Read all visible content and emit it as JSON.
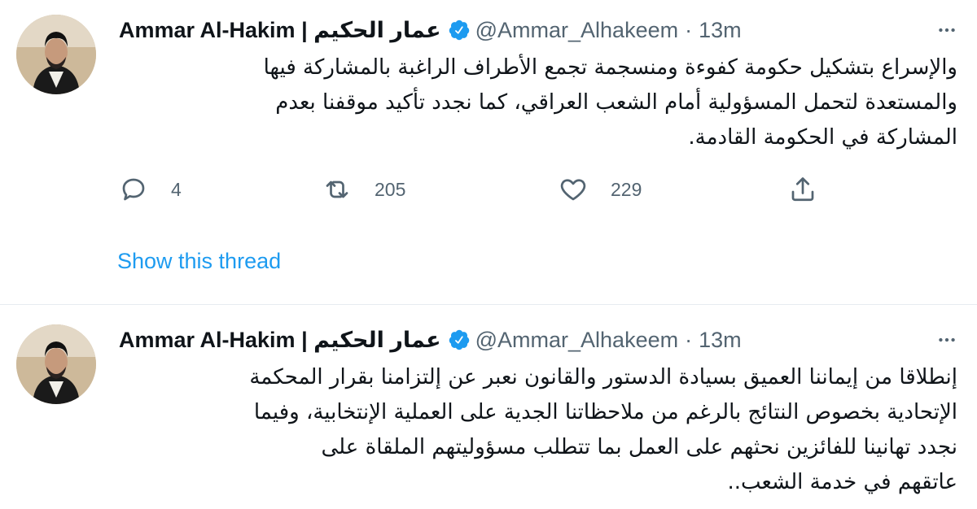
{
  "tweets": [
    {
      "display_name": "Ammar Al-Hakim | عمار الحكيم",
      "handle": "@Ammar_Alhakeem",
      "separator": "·",
      "time": "13m",
      "text": "والإسراع بتشكيل حكومة كفوءة ومنسجمة تجمع الأطراف الراغبة بالمشاركة فيها\nوالمستعدة لتحمل المسؤولية أمام الشعب العراقي، كما نجدد تأكيد موقفنا بعدم\nالمشاركة في الحكومة القادمة.",
      "replies": "4",
      "retweets": "205",
      "likes": "229",
      "show_thread": "Show this thread"
    },
    {
      "display_name": "Ammar Al-Hakim | عمار الحكيم",
      "handle": "@Ammar_Alhakeem",
      "separator": "·",
      "time": "13m",
      "text": "إنطلاقا من إيماننا العميق بسيادة الدستور والقانون نعبر عن إلتزامنا بقرار المحكمة\nالإتحادية بخصوص النتائج بالرغم من ملاحظاتنا الجدية على العملية الإنتخابية، وفيما\nنجدد تهانينا للفائزين نحثهم على العمل بما تتطلب مسؤوليتهم الملقاة على\nعاتقهم في خدمة الشعب.."
    }
  ],
  "icons": {
    "verified": "verified-badge-icon",
    "more": "more-horizontal-icon",
    "reply": "reply-icon",
    "retweet": "retweet-icon",
    "like": "heart-icon",
    "share": "share-icon"
  },
  "colors": {
    "accent": "#1d9bf0",
    "muted": "#536471",
    "text": "#0f1419",
    "divider": "#e6ecf0"
  }
}
